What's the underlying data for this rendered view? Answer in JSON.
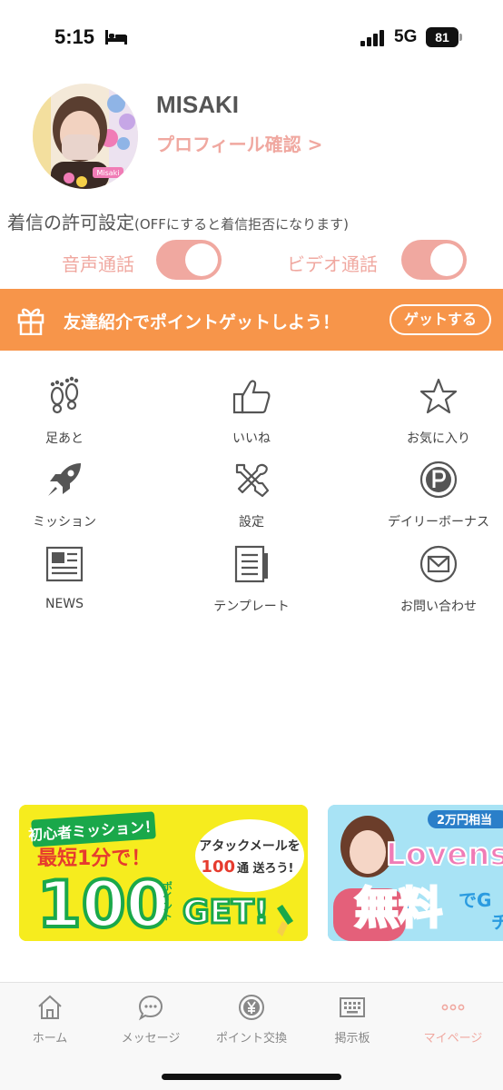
{
  "status_bar": {
    "time": "5:15",
    "network": "5G",
    "battery": "81"
  },
  "profile": {
    "name": "MISAKI",
    "link": "プロフィール確認 >",
    "avatar_caption": "Misaki"
  },
  "call_settings": {
    "title": "着信の許可設定",
    "note": "(OFFにすると着信拒否になります)",
    "voice_label": "音声通話",
    "video_label": "ビデオ通話",
    "voice_on": true,
    "video_on": true
  },
  "referral": {
    "text": "友達紹介でポイントゲットしよう！",
    "button": "ゲットする"
  },
  "menu": [
    {
      "label": "足あと",
      "icon": "footprints-icon"
    },
    {
      "label": "いいね",
      "icon": "thumbs-up-icon"
    },
    {
      "label": "お気に入り",
      "icon": "star-icon"
    },
    {
      "label": "ミッション",
      "icon": "rocket-icon"
    },
    {
      "label": "設定",
      "icon": "tools-icon"
    },
    {
      "label": "デイリーボーナス",
      "icon": "p-coin-icon"
    },
    {
      "label": "NEWS",
      "icon": "newspaper-icon"
    },
    {
      "label": "テンプレート",
      "icon": "document-icon"
    },
    {
      "label": "お問い合わせ",
      "icon": "mail-icon"
    }
  ],
  "promo1": {
    "badge": "初心者ミッション！",
    "line1": "最短1分で！",
    "big": "100",
    "unit": "ポイント",
    "get": "GET!",
    "bubble1": "アタックメールを",
    "bubble2_num": "100",
    "bubble2_rest": "通 送ろう!"
  },
  "promo2": {
    "top": "2万円相当",
    "brand": "Lovens",
    "big": "無料",
    "side": "でG",
    "side2": "チ"
  },
  "tabs": [
    {
      "label": "ホーム",
      "icon": "home-icon",
      "active": false
    },
    {
      "label": "メッセージ",
      "icon": "chat-bubble-icon",
      "active": false
    },
    {
      "label": "ポイント交換",
      "icon": "yen-coin-icon",
      "active": false
    },
    {
      "label": "掲示板",
      "icon": "keyboard-icon",
      "active": false
    },
    {
      "label": "マイページ",
      "icon": "more-dots-icon",
      "active": true
    }
  ],
  "colors": {
    "accent_pink": "#f0a8a0",
    "banner_orange": "#f7954a",
    "icon_gray": "#555555"
  }
}
